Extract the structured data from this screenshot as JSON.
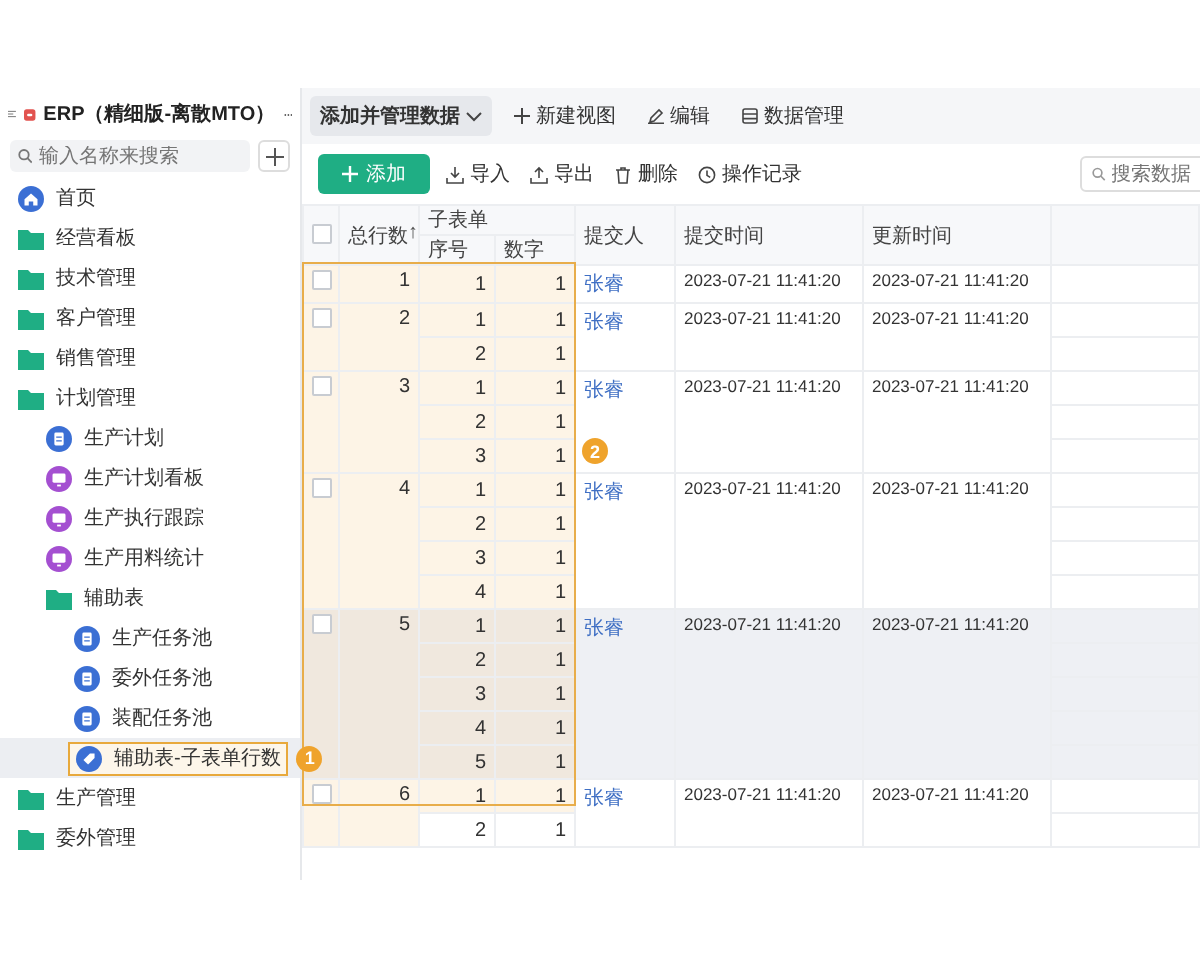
{
  "sidebar": {
    "app_title": "ERP（精细版-离散MTO）",
    "search_placeholder": "输入名称来搜索",
    "items": [
      {
        "label": "首页",
        "kind": "home",
        "selected": false
      },
      {
        "label": "经营看板",
        "kind": "folder",
        "selected": false
      },
      {
        "label": "技术管理",
        "kind": "folder",
        "selected": false
      },
      {
        "label": "客户管理",
        "kind": "folder",
        "selected": false
      },
      {
        "label": "销售管理",
        "kind": "folder",
        "selected": false
      },
      {
        "label": "计划管理",
        "kind": "folder",
        "selected": false,
        "children": [
          {
            "label": "生产计划",
            "kind": "form",
            "selected": false
          },
          {
            "label": "生产计划看板",
            "kind": "board",
            "selected": false
          },
          {
            "label": "生产执行跟踪",
            "kind": "board",
            "selected": false
          },
          {
            "label": "生产用料统计",
            "kind": "board",
            "selected": false
          },
          {
            "label": "辅助表",
            "kind": "folder",
            "selected": false,
            "children": [
              {
                "label": "生产任务池",
                "kind": "form",
                "selected": false
              },
              {
                "label": "委外任务池",
                "kind": "form",
                "selected": false
              },
              {
                "label": "装配任务池",
                "kind": "form",
                "selected": false
              },
              {
                "label": "辅助表-子表单行数",
                "kind": "tag",
                "selected": true,
                "annotation": "1"
              }
            ]
          }
        ]
      },
      {
        "label": "生产管理",
        "kind": "folder",
        "selected": false
      },
      {
        "label": "委外管理",
        "kind": "folder",
        "selected": false
      }
    ]
  },
  "toolbar": [
    {
      "label": "添加并管理数据",
      "kind": "dropdown",
      "selected": true
    },
    {
      "label": "新建视图",
      "kind": "add",
      "selected": false
    },
    {
      "label": "编辑",
      "kind": "edit",
      "selected": false
    },
    {
      "label": "数据管理",
      "kind": "data",
      "selected": false
    }
  ],
  "actions": [
    {
      "label": "添加",
      "kind": "primary"
    },
    {
      "label": "导入",
      "kind": "import"
    },
    {
      "label": "导出",
      "kind": "export"
    },
    {
      "label": "删除",
      "kind": "delete"
    },
    {
      "label": "操作记录",
      "kind": "history"
    }
  ],
  "search": {
    "placeholder": "搜索数据"
  },
  "table": {
    "columns": {
      "total": "总行数",
      "sort_mark": "↑",
      "group": "子表单",
      "seq": "序号",
      "number": "数字",
      "submitter": "提交人",
      "submitted": "提交时间",
      "updated": "更新时间"
    },
    "annotation": "2",
    "all_checked": false,
    "rows": [
      {
        "checked": false,
        "total": "1",
        "submitter": "张睿",
        "submitted": "2023-07-21 11:41:20",
        "updated": "2023-07-21 11:41:20",
        "hovered": false,
        "subrows": [
          {
            "seq": "1",
            "number": "1",
            "highlighted": true
          }
        ]
      },
      {
        "checked": false,
        "total": "2",
        "submitter": "张睿",
        "submitted": "2023-07-21 11:41:20",
        "updated": "2023-07-21 11:41:20",
        "hovered": false,
        "subrows": [
          {
            "seq": "1",
            "number": "1",
            "highlighted": true
          },
          {
            "seq": "2",
            "number": "1",
            "highlighted": true
          }
        ]
      },
      {
        "checked": false,
        "total": "3",
        "submitter": "张睿",
        "submitted": "2023-07-21 11:41:20",
        "updated": "2023-07-21 11:41:20",
        "hovered": false,
        "subrows": [
          {
            "seq": "1",
            "number": "1",
            "highlighted": true
          },
          {
            "seq": "2",
            "number": "1",
            "highlighted": true
          },
          {
            "seq": "3",
            "number": "1",
            "highlighted": true
          }
        ]
      },
      {
        "checked": false,
        "total": "4",
        "submitter": "张睿",
        "submitted": "2023-07-21 11:41:20",
        "updated": "2023-07-21 11:41:20",
        "hovered": false,
        "subrows": [
          {
            "seq": "1",
            "number": "1",
            "highlighted": true
          },
          {
            "seq": "2",
            "number": "1",
            "highlighted": true
          },
          {
            "seq": "3",
            "number": "1",
            "highlighted": true
          },
          {
            "seq": "4",
            "number": "1",
            "highlighted": true
          }
        ]
      },
      {
        "checked": false,
        "total": "5",
        "submitter": "张睿",
        "submitted": "2023-07-21 11:41:20",
        "updated": "2023-07-21 11:41:20",
        "hovered": true,
        "subrows": [
          {
            "seq": "1",
            "number": "1",
            "highlighted": true
          },
          {
            "seq": "2",
            "number": "1",
            "highlighted": true
          },
          {
            "seq": "3",
            "number": "1",
            "highlighted": true
          },
          {
            "seq": "4",
            "number": "1",
            "highlighted": true
          },
          {
            "seq": "5",
            "number": "1",
            "highlighted": true
          }
        ]
      },
      {
        "checked": false,
        "total": "6",
        "submitter": "张睿",
        "submitted": "2023-07-21 11:41:20",
        "updated": "2023-07-21 11:41:20",
        "hovered": false,
        "subrows": [
          {
            "seq": "1",
            "number": "1",
            "highlighted": true
          },
          {
            "seq": "2",
            "number": "1",
            "highlighted": false
          }
        ]
      }
    ]
  }
}
